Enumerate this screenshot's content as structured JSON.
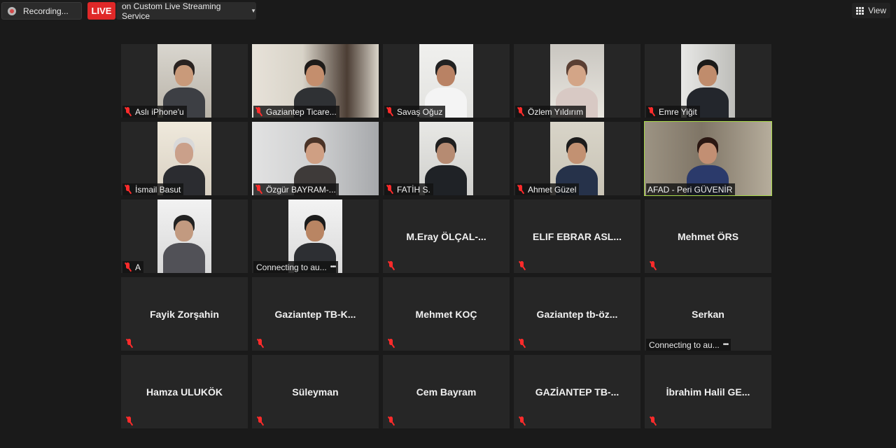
{
  "toolbar": {
    "recording_label": "Recording...",
    "live_label": "LIVE",
    "stream_label": "on Custom Live Streaming Service",
    "view_label": "View"
  },
  "participants": [
    {
      "name": "Aslı iPhone'u",
      "video": true,
      "muted": true
    },
    {
      "name": "Gaziantep Ticare...",
      "video": true,
      "muted": true
    },
    {
      "name": "Savaş Oğuz",
      "video": true,
      "muted": true
    },
    {
      "name": "Özlem Yıldırım",
      "video": true,
      "muted": true
    },
    {
      "name": "Emre Yiğit",
      "video": true,
      "muted": true
    },
    {
      "name": "İsmail Basut",
      "video": true,
      "muted": true
    },
    {
      "name": "Özgür BAYRAM-...",
      "video": true,
      "muted": true
    },
    {
      "name": "FATİH S.",
      "video": true,
      "muted": true
    },
    {
      "name": "Ahmet Güzel",
      "video": true,
      "muted": true
    },
    {
      "name": "AFAD - Peri GÜVENİR",
      "video": true,
      "muted": false,
      "active": true
    },
    {
      "name": "A",
      "video": true,
      "muted": true
    },
    {
      "name": "",
      "video": true,
      "muted": false,
      "status": "Connecting to au..."
    },
    {
      "name": "M.Eray  ÖLÇAL-...",
      "video": false,
      "muted": true
    },
    {
      "name": "ELIF EBRAR ASL...",
      "video": false,
      "muted": true
    },
    {
      "name": "Mehmet ÖRS",
      "video": false,
      "muted": true
    },
    {
      "name": "Fayik Zorşahin",
      "video": false,
      "muted": true
    },
    {
      "name": "Gaziantep  TB-K...",
      "video": false,
      "muted": true
    },
    {
      "name": "Mehmet KOÇ",
      "video": false,
      "muted": true
    },
    {
      "name": "Gaziantep  tb-öz...",
      "video": false,
      "muted": true
    },
    {
      "name": "Serkan",
      "video": false,
      "muted": false,
      "status": "Connecting to au..."
    },
    {
      "name": "Hamza ULUKÖK",
      "video": false,
      "muted": true
    },
    {
      "name": "Süleyman",
      "video": false,
      "muted": true
    },
    {
      "name": "Cem Bayram",
      "video": false,
      "muted": true
    },
    {
      "name": "GAZİANTEP TB-...",
      "video": false,
      "muted": true
    },
    {
      "name": "İbrahim  Halil  GE...",
      "video": false,
      "muted": true
    }
  ],
  "colors": {
    "live": "#e02828",
    "active_speaker_border": "#a9d84a",
    "muted_icon": "#ff2b2b",
    "tile_background": "#262626"
  }
}
